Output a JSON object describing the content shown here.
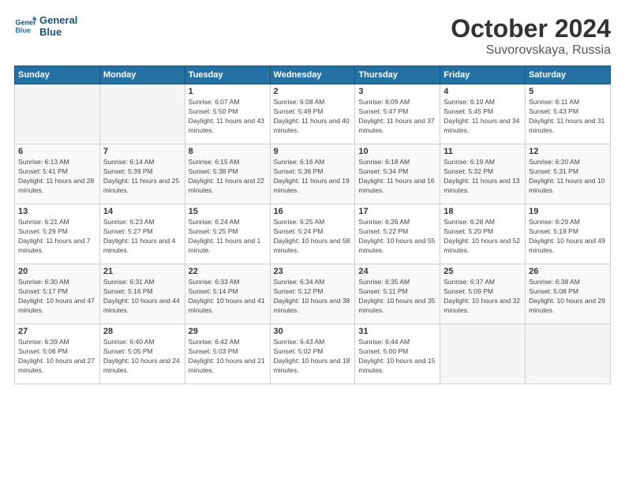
{
  "header": {
    "logo_line1": "General",
    "logo_line2": "Blue",
    "month": "October 2024",
    "location": "Suvorovskaya, Russia"
  },
  "days_of_week": [
    "Sunday",
    "Monday",
    "Tuesday",
    "Wednesday",
    "Thursday",
    "Friday",
    "Saturday"
  ],
  "weeks": [
    [
      {
        "day": "",
        "empty": true
      },
      {
        "day": "",
        "empty": true
      },
      {
        "day": "1",
        "sunrise": "6:07 AM",
        "sunset": "5:50 PM",
        "daylight": "11 hours and 43 minutes."
      },
      {
        "day": "2",
        "sunrise": "6:08 AM",
        "sunset": "5:49 PM",
        "daylight": "11 hours and 40 minutes."
      },
      {
        "day": "3",
        "sunrise": "6:09 AM",
        "sunset": "5:47 PM",
        "daylight": "11 hours and 37 minutes."
      },
      {
        "day": "4",
        "sunrise": "6:10 AM",
        "sunset": "5:45 PM",
        "daylight": "11 hours and 34 minutes."
      },
      {
        "day": "5",
        "sunrise": "6:11 AM",
        "sunset": "5:43 PM",
        "daylight": "11 hours and 31 minutes."
      }
    ],
    [
      {
        "day": "6",
        "sunrise": "6:13 AM",
        "sunset": "5:41 PM",
        "daylight": "11 hours and 28 minutes."
      },
      {
        "day": "7",
        "sunrise": "6:14 AM",
        "sunset": "5:39 PM",
        "daylight": "11 hours and 25 minutes."
      },
      {
        "day": "8",
        "sunrise": "6:15 AM",
        "sunset": "5:38 PM",
        "daylight": "11 hours and 22 minutes."
      },
      {
        "day": "9",
        "sunrise": "6:16 AM",
        "sunset": "5:36 PM",
        "daylight": "11 hours and 19 minutes."
      },
      {
        "day": "10",
        "sunrise": "6:18 AM",
        "sunset": "5:34 PM",
        "daylight": "11 hours and 16 minutes."
      },
      {
        "day": "11",
        "sunrise": "6:19 AM",
        "sunset": "5:32 PM",
        "daylight": "11 hours and 13 minutes."
      },
      {
        "day": "12",
        "sunrise": "6:20 AM",
        "sunset": "5:31 PM",
        "daylight": "11 hours and 10 minutes."
      }
    ],
    [
      {
        "day": "13",
        "sunrise": "6:21 AM",
        "sunset": "5:29 PM",
        "daylight": "11 hours and 7 minutes."
      },
      {
        "day": "14",
        "sunrise": "6:23 AM",
        "sunset": "5:27 PM",
        "daylight": "11 hours and 4 minutes."
      },
      {
        "day": "15",
        "sunrise": "6:24 AM",
        "sunset": "5:25 PM",
        "daylight": "11 hours and 1 minute."
      },
      {
        "day": "16",
        "sunrise": "6:25 AM",
        "sunset": "5:24 PM",
        "daylight": "10 hours and 58 minutes."
      },
      {
        "day": "17",
        "sunrise": "6:26 AM",
        "sunset": "5:22 PM",
        "daylight": "10 hours and 55 minutes."
      },
      {
        "day": "18",
        "sunrise": "6:28 AM",
        "sunset": "5:20 PM",
        "daylight": "10 hours and 52 minutes."
      },
      {
        "day": "19",
        "sunrise": "6:29 AM",
        "sunset": "5:19 PM",
        "daylight": "10 hours and 49 minutes."
      }
    ],
    [
      {
        "day": "20",
        "sunrise": "6:30 AM",
        "sunset": "5:17 PM",
        "daylight": "10 hours and 47 minutes."
      },
      {
        "day": "21",
        "sunrise": "6:31 AM",
        "sunset": "5:16 PM",
        "daylight": "10 hours and 44 minutes."
      },
      {
        "day": "22",
        "sunrise": "6:33 AM",
        "sunset": "5:14 PM",
        "daylight": "10 hours and 41 minutes."
      },
      {
        "day": "23",
        "sunrise": "6:34 AM",
        "sunset": "5:12 PM",
        "daylight": "10 hours and 38 minutes."
      },
      {
        "day": "24",
        "sunrise": "6:35 AM",
        "sunset": "5:11 PM",
        "daylight": "10 hours and 35 minutes."
      },
      {
        "day": "25",
        "sunrise": "6:37 AM",
        "sunset": "5:09 PM",
        "daylight": "10 hours and 32 minutes."
      },
      {
        "day": "26",
        "sunrise": "6:38 AM",
        "sunset": "5:08 PM",
        "daylight": "10 hours and 29 minutes."
      }
    ],
    [
      {
        "day": "27",
        "sunrise": "6:39 AM",
        "sunset": "5:06 PM",
        "daylight": "10 hours and 27 minutes."
      },
      {
        "day": "28",
        "sunrise": "6:40 AM",
        "sunset": "5:05 PM",
        "daylight": "10 hours and 24 minutes."
      },
      {
        "day": "29",
        "sunrise": "6:42 AM",
        "sunset": "5:03 PM",
        "daylight": "10 hours and 21 minutes."
      },
      {
        "day": "30",
        "sunrise": "6:43 AM",
        "sunset": "5:02 PM",
        "daylight": "10 hours and 18 minutes."
      },
      {
        "day": "31",
        "sunrise": "6:44 AM",
        "sunset": "5:00 PM",
        "daylight": "10 hours and 15 minutes."
      },
      {
        "day": "",
        "empty": true
      },
      {
        "day": "",
        "empty": true
      }
    ]
  ],
  "labels": {
    "sunrise": "Sunrise:",
    "sunset": "Sunset:",
    "daylight": "Daylight:"
  }
}
